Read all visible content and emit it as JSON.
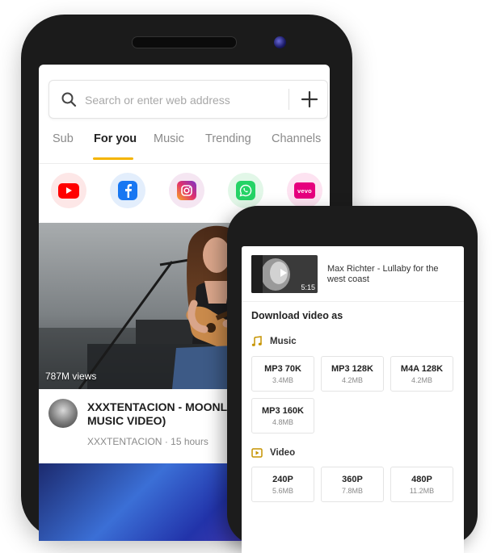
{
  "search": {
    "placeholder": "Search or enter web address"
  },
  "tabs": [
    {
      "label": "Sub"
    },
    {
      "label": "For you"
    },
    {
      "label": "Music"
    },
    {
      "label": "Trending"
    },
    {
      "label": "Channels"
    }
  ],
  "shortcuts": {
    "vevo_label": "vevo"
  },
  "feed": {
    "video1": {
      "views": "787M views",
      "title": "XXXTENTACION - MOONLIGHT\nMUSIC VIDEO)",
      "channel": "XXXTENTACION",
      "time": "· 15 hours"
    }
  },
  "download": {
    "video_title": "Max Richter - Lullaby for the west coast",
    "duration": "5:15",
    "heading": "Download video as",
    "music_label": "Music",
    "video_label": "Video",
    "music_formats": [
      {
        "quality": "MP3 70K",
        "size": "3.4MB"
      },
      {
        "quality": "MP3 128K",
        "size": "4.2MB"
      },
      {
        "quality": "M4A 128K",
        "size": "4.2MB"
      },
      {
        "quality": "MP3 160K",
        "size": "4.8MB"
      }
    ],
    "video_formats": [
      {
        "quality": "240P",
        "size": "5.6MB"
      },
      {
        "quality": "360P",
        "size": "7.8MB"
      },
      {
        "quality": "480P",
        "size": "11.2MB"
      }
    ]
  },
  "colors": {
    "accent": "#f5b400",
    "youtube": "#ff0000",
    "facebook": "#1877f2",
    "whatsapp": "#25d366",
    "vevo": "#e6007e"
  }
}
